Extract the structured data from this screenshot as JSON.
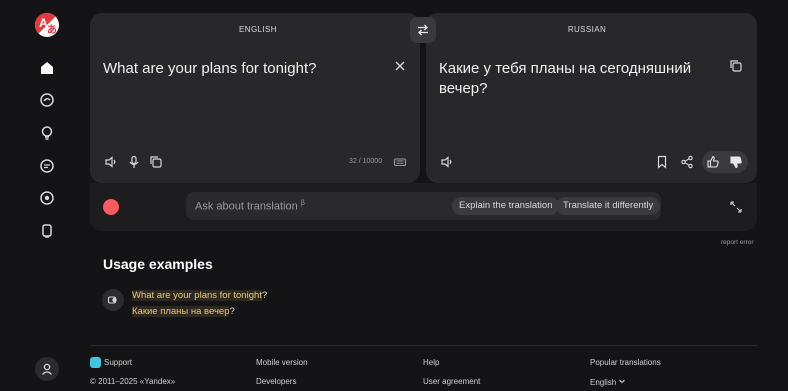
{
  "sidebar": {
    "logo_letters": [
      "A",
      "あ"
    ],
    "items": [
      {
        "icon": "home-icon"
      },
      {
        "icon": "chat-icon"
      },
      {
        "icon": "lightbulb-icon"
      },
      {
        "icon": "message-icon"
      },
      {
        "icon": "target-icon"
      },
      {
        "icon": "cards-icon"
      }
    ],
    "avatar_icon": "user-icon"
  },
  "translator": {
    "source_lang": "ENGLISH",
    "target_lang": "RUSSIAN",
    "source_text": "What are your plans for tonight?",
    "target_text": "Какие у тебя планы на сегодняшний вечер?",
    "char_counter": "32 / 10000"
  },
  "assistant": {
    "placeholder": "Ask about translation",
    "beta_mark": "β",
    "chips": [
      "Explain the translation",
      "Translate it differently"
    ]
  },
  "report_label": "report error",
  "usage": {
    "title": "Usage examples",
    "en_highlight": "What are your plans for tonight",
    "en_tail": "?",
    "ru_highlight": "Какие планы на вечер",
    "ru_tail": "?"
  },
  "footer": {
    "col1": [
      "Support",
      "© 2011–2025 «Yandex»"
    ],
    "col2": [
      "Mobile version",
      "Developers"
    ],
    "col3": [
      "Help",
      "User agreement"
    ],
    "col4": [
      "Popular translations",
      "English"
    ]
  },
  "colors": {
    "background": "#141416",
    "panel": "#28282b",
    "highlight": "#e7c77a",
    "accent_red": "#e5383b"
  }
}
